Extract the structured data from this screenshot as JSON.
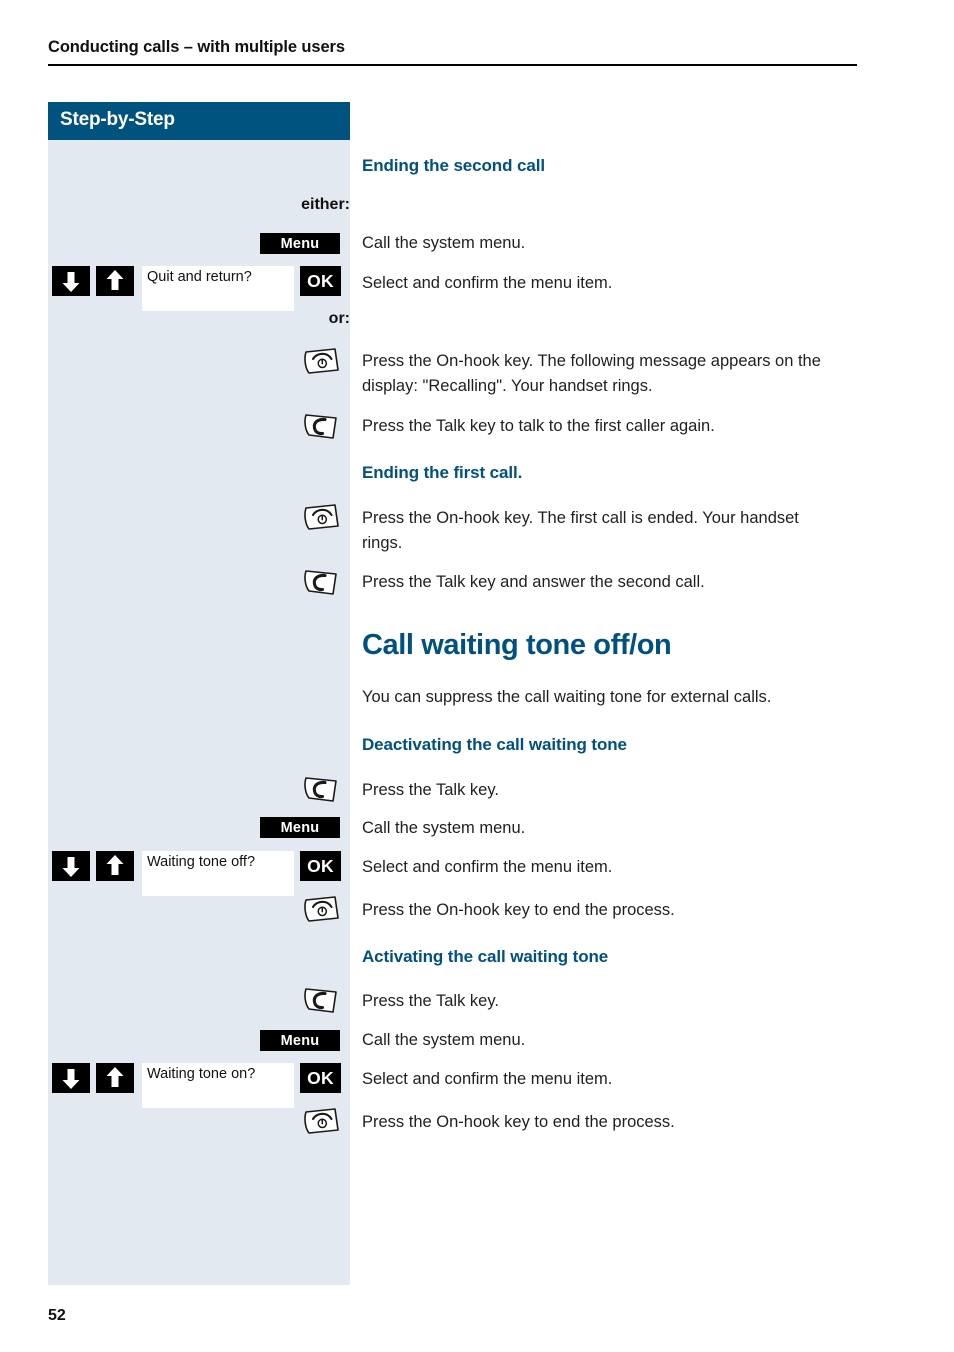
{
  "page": {
    "running_header": "Conducting calls – with multiple users",
    "folio": "52",
    "colors": {
      "accent_blue": "#00517f",
      "banner_blue": "#01537f",
      "sidebar_bg": "#e3e9f1",
      "key_black": "#000000"
    }
  },
  "sidebar": {
    "banner_label": "Step-by-Step",
    "cues": {
      "either": "either:",
      "or": "or:"
    },
    "soft_keys": {
      "menu": "Menu",
      "ok": "OK"
    },
    "displays": {
      "quit_and_return": "Quit and return?",
      "waiting_tone_off": "Waiting tone off?",
      "waiting_tone_on": "Waiting tone on?"
    },
    "icons": {
      "arrow_down": "arrow-down-key",
      "arrow_up": "arrow-up-key",
      "talk_key": "talk-key",
      "on_hook_key": "on-hook-key"
    }
  },
  "main": {
    "headings": {
      "ending_second_call": "Ending the second call",
      "ending_first_call": "Ending the first call.",
      "call_waiting_tone": "Call waiting tone off/on",
      "deactivating": "Deactivating the call waiting tone",
      "activating": "Activating the call waiting tone"
    },
    "paragraphs": {
      "call_system_menu_1": "Call the system menu.",
      "select_confirm_1": "Select and confirm the menu item.",
      "on_hook_recalling": "Press the On-hook key. The following message appears on the display: \"Recalling\". Your handset rings.",
      "talk_first_caller": "Press the Talk key to talk to the first caller again.",
      "on_hook_first_ended": "Press the On-hook key. The first call is ended. Your handset rings.",
      "talk_answer_second": "Press the Talk key and answer the second call.",
      "suppress_intro": "You can suppress the call waiting tone for external calls.",
      "press_talk_1": "Press the Talk key.",
      "call_system_menu_2": "Call the system menu.",
      "select_confirm_2": "Select and confirm the menu item.",
      "on_hook_end_1": "Press the On-hook key to end the process.",
      "press_talk_2": "Press the Talk key.",
      "call_system_menu_3": "Call the system menu.",
      "select_confirm_3": "Select and confirm the menu item.",
      "on_hook_end_2": "Press the On-hook key to end the process."
    }
  }
}
